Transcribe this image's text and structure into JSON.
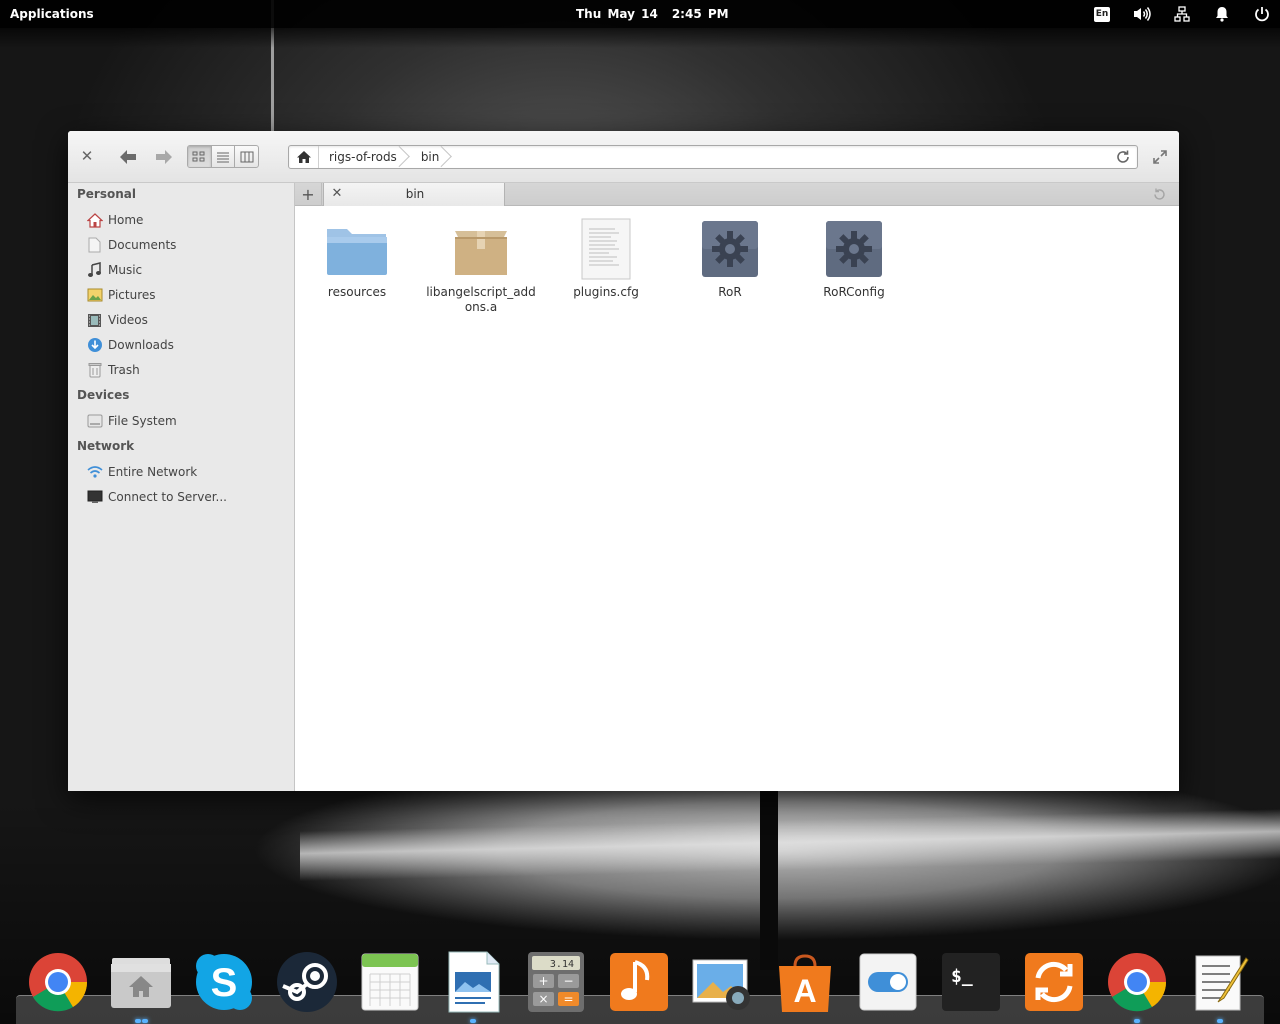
{
  "panel": {
    "applications": "Applications",
    "date": "Thu May 14",
    "time": "2:45 PM",
    "keyboard_layout": "En",
    "indicators": [
      "keyboard-layout-icon",
      "volume-icon",
      "network-icon",
      "notifications-icon",
      "power-icon"
    ]
  },
  "window": {
    "pathbar": {
      "crumbs": [
        "rigs-of-rods",
        "bin"
      ]
    },
    "view_modes": [
      "icon-view",
      "list-view",
      "column-view"
    ],
    "active_view": "icon-view",
    "sidebar": {
      "sections": [
        {
          "heading": "Personal",
          "items": [
            {
              "label": "Home",
              "icon": "home-icon"
            },
            {
              "label": "Documents",
              "icon": "documents-icon"
            },
            {
              "label": "Music",
              "icon": "music-icon"
            },
            {
              "label": "Pictures",
              "icon": "pictures-icon"
            },
            {
              "label": "Videos",
              "icon": "videos-icon"
            },
            {
              "label": "Downloads",
              "icon": "downloads-icon"
            },
            {
              "label": "Trash",
              "icon": "trash-icon"
            }
          ]
        },
        {
          "heading": "Devices",
          "items": [
            {
              "label": "File System",
              "icon": "drive-icon"
            }
          ]
        },
        {
          "heading": "Network",
          "items": [
            {
              "label": "Entire Network",
              "icon": "network-wireless-icon"
            },
            {
              "label": "Connect to Server...",
              "icon": "server-icon"
            }
          ]
        }
      ]
    },
    "tabs": [
      {
        "label": "bin"
      }
    ],
    "files": [
      {
        "name": "resources",
        "type": "folder"
      },
      {
        "name": "libangelscript_addons.a",
        "type": "archive"
      },
      {
        "name": "plugins.cfg",
        "type": "text"
      },
      {
        "name": "RoR",
        "type": "executable"
      },
      {
        "name": "RoRConfig",
        "type": "executable"
      }
    ]
  },
  "dock": {
    "items": [
      {
        "name": "chrome",
        "icon": "chrome-icon"
      },
      {
        "name": "files",
        "icon": "files-icon"
      },
      {
        "name": "skype",
        "icon": "skype-icon"
      },
      {
        "name": "steam",
        "icon": "steam-icon"
      },
      {
        "name": "calendar",
        "icon": "calendar-icon"
      },
      {
        "name": "writer",
        "icon": "writer-icon"
      },
      {
        "name": "calculator",
        "icon": "calculator-icon",
        "display": "3.14"
      },
      {
        "name": "music",
        "icon": "music-player-icon"
      },
      {
        "name": "photos",
        "icon": "photos-icon"
      },
      {
        "name": "software-center",
        "icon": "software-center-icon"
      },
      {
        "name": "settings",
        "icon": "settings-toggle-icon"
      },
      {
        "name": "terminal",
        "icon": "terminal-icon",
        "prompt": "$_"
      },
      {
        "name": "updater",
        "icon": "updater-icon"
      },
      {
        "name": "chrome-2",
        "icon": "chrome-icon"
      },
      {
        "name": "notes",
        "icon": "notes-icon"
      }
    ]
  },
  "colors": {
    "accent": "#5ab3ff",
    "folder": "#7fb1dd",
    "executable": "#5f6b80",
    "sidebar_bg": "#e9e9e9"
  }
}
